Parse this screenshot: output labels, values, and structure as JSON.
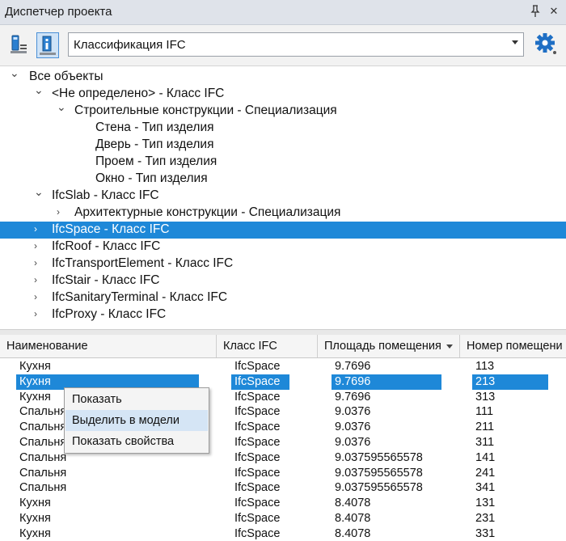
{
  "window": {
    "title": "Диспетчер проекта",
    "pin_icon": "pin-icon",
    "close_icon": "close-icon"
  },
  "toolbar": {
    "buttons": [
      "list-view-icon",
      "info-icon"
    ],
    "dropdown_value": "Классификация IFC",
    "settings_icon": "gear-settings-icon"
  },
  "tree": {
    "items": [
      {
        "label": "Все объекты",
        "level": 0,
        "expander": "expanded"
      },
      {
        "label": "<Не определено> - Класс IFC",
        "level": 1,
        "expander": "expanded"
      },
      {
        "label": "Строительные конструкции - Специализация",
        "level": 2,
        "expander": "expanded"
      },
      {
        "label": "Стена - Тип изделия",
        "level": 3,
        "expander": "none"
      },
      {
        "label": "Дверь - Тип изделия",
        "level": 3,
        "expander": "none"
      },
      {
        "label": "Проем - Тип изделия",
        "level": 3,
        "expander": "none"
      },
      {
        "label": "Окно - Тип изделия",
        "level": 3,
        "expander": "none"
      },
      {
        "label": "IfcSlab - Класс IFC",
        "level": 1,
        "expander": "expanded"
      },
      {
        "label": "Архитектурные конструкции - Специализация",
        "level": 2,
        "expander": "collapsed"
      },
      {
        "label": "IfcSpace - Класс IFC",
        "level": 1,
        "expander": "collapsed",
        "selected": true
      },
      {
        "label": "IfcRoof - Класс IFC",
        "level": 1,
        "expander": "collapsed"
      },
      {
        "label": "IfcTransportElement - Класс IFC",
        "level": 1,
        "expander": "collapsed"
      },
      {
        "label": "IfcStair - Класс IFC",
        "level": 1,
        "expander": "collapsed"
      },
      {
        "label": "IfcSanitaryTerminal - Класс IFC",
        "level": 1,
        "expander": "collapsed"
      },
      {
        "label": "IfcProxy - Класс IFC",
        "level": 1,
        "expander": "collapsed"
      }
    ]
  },
  "table": {
    "columns": [
      "Наименование",
      "Класс IFC",
      "Площадь помещения",
      "Номер помещени"
    ],
    "sorted_column": "Площадь помещения",
    "rows": [
      {
        "name": "Кухня",
        "class": "IfcSpace",
        "area": "9.7696",
        "number": "113"
      },
      {
        "name": "Кухня",
        "class": "IfcSpace",
        "area": "9.7696",
        "number": "213",
        "selected": true
      },
      {
        "name": "Кухня",
        "class": "IfcSpace",
        "area": "9.7696",
        "number": "313"
      },
      {
        "name": "Спальня",
        "class": "IfcSpace",
        "area": "9.0376",
        "number": "111"
      },
      {
        "name": "Спальня",
        "class": "IfcSpace",
        "area": "9.0376",
        "number": "211"
      },
      {
        "name": "Спальня",
        "class": "IfcSpace",
        "area": "9.0376",
        "number": "311"
      },
      {
        "name": "Спальня",
        "class": "IfcSpace",
        "area": "9.037595565578",
        "number": "141"
      },
      {
        "name": "Спальня",
        "class": "IfcSpace",
        "area": "9.037595565578",
        "number": "241"
      },
      {
        "name": "Спальня",
        "class": "IfcSpace",
        "area": "9.037595565578",
        "number": "341"
      },
      {
        "name": "Кухня",
        "class": "IfcSpace",
        "area": "8.4078",
        "number": "131"
      },
      {
        "name": "Кухня",
        "class": "IfcSpace",
        "area": "8.4078",
        "number": "231"
      },
      {
        "name": "Кухня",
        "class": "IfcSpace",
        "area": "8.4078",
        "number": "331"
      }
    ]
  },
  "context_menu": {
    "items": [
      {
        "label": "Показать"
      },
      {
        "label": "Выделить в модели",
        "hover": true
      },
      {
        "label": "Показать свойства"
      }
    ]
  },
  "colors": {
    "selection": "#1e88d8",
    "menu_hover": "#d5e5f5"
  }
}
